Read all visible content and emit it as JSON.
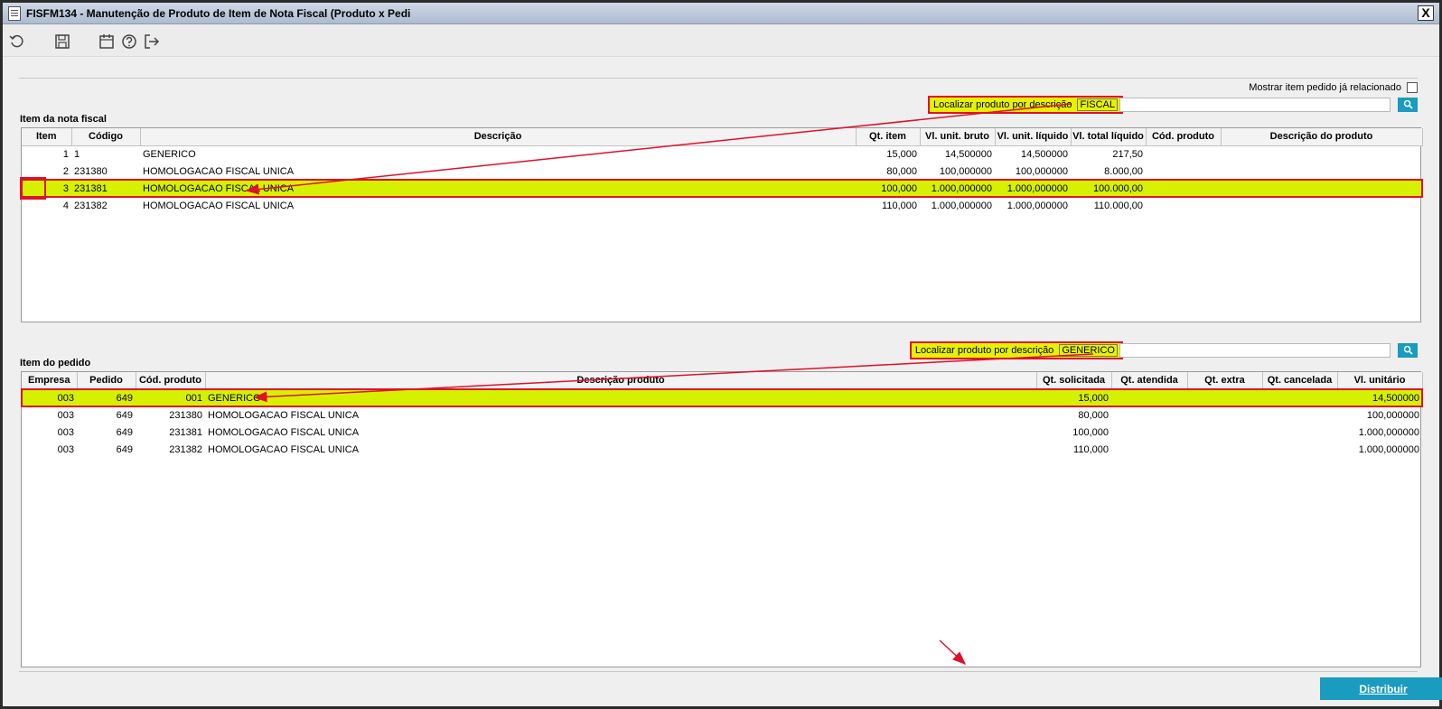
{
  "window": {
    "title": "FISFM134 - Manutenção de Produto de Item de Nota Fiscal (Produto x Pedi",
    "close_label": "X"
  },
  "toolbar": {
    "buttons": [
      {
        "name": "refresh-icon"
      },
      {
        "name": "save-icon"
      },
      {
        "name": "calendar-icon"
      },
      {
        "name": "help-icon"
      },
      {
        "name": "exit-icon"
      }
    ]
  },
  "options": {
    "show_related_label": "Mostrar item pedido já relacionado"
  },
  "nota_fiscal": {
    "section_title": "Item da nota fiscal",
    "search_label": "Localizar produto por descrição",
    "search_value": "FISCAL",
    "columns": [
      "Item",
      "Código",
      "Descrição",
      "Qt. item",
      "Vl. unit. bruto",
      "Vl. unit. líquido",
      "Vl. total líquido",
      "Cód. produto",
      "Descrição do produto"
    ],
    "rows": [
      {
        "item": "1",
        "codigo": "1",
        "descricao": "GENERICO",
        "qt_item": "15,000",
        "vl_unit_bruto": "14,500000",
        "vl_unit_liquido": "14,500000",
        "vl_total_liquido": "217,50",
        "cod_produto": "",
        "desc_produto": ""
      },
      {
        "item": "2",
        "codigo": "231380",
        "descricao": "HOMOLOGACAO FISCAL UNICA",
        "qt_item": "80,000",
        "vl_unit_bruto": "100,000000",
        "vl_unit_liquido": "100,000000",
        "vl_total_liquido": "8.000,00",
        "cod_produto": "",
        "desc_produto": ""
      },
      {
        "item": "3",
        "codigo": "231381",
        "descricao": "HOMOLOGACAO FISCAL UNICA",
        "qt_item": "100,000",
        "vl_unit_bruto": "1.000,000000",
        "vl_unit_liquido": "1.000,000000",
        "vl_total_liquido": "100.000,00",
        "cod_produto": "",
        "desc_produto": ""
      },
      {
        "item": "4",
        "codigo": "231382",
        "descricao": "HOMOLOGACAO FISCAL UNICA",
        "qt_item": "110,000",
        "vl_unit_bruto": "1.000,000000",
        "vl_unit_liquido": "1.000,000000",
        "vl_total_liquido": "110.000,00",
        "cod_produto": "",
        "desc_produto": ""
      }
    ]
  },
  "pedido": {
    "section_title": "Item do pedido",
    "search_label": "Localizar produto por descrição",
    "search_value": "GENERICO",
    "columns": [
      "Empresa",
      "Pedido",
      "Cód. produto",
      "Descrição produto",
      "Qt. solicitada",
      "Qt. atendida",
      "Qt. extra",
      "Qt. cancelada",
      "Vl. unitário"
    ],
    "rows": [
      {
        "empresa": "003",
        "pedido": "649",
        "cod_produto": "001",
        "descricao": "GENERICO",
        "qt_solicitada": "15,000",
        "qt_atendida": "",
        "qt_extra": "",
        "qt_cancelada": "",
        "vl_unitario": "14,500000"
      },
      {
        "empresa": "003",
        "pedido": "649",
        "cod_produto": "231380",
        "descricao": "HOMOLOGACAO FISCAL UNICA",
        "qt_solicitada": "80,000",
        "qt_atendida": "",
        "qt_extra": "",
        "qt_cancelada": "",
        "vl_unitario": "100,000000"
      },
      {
        "empresa": "003",
        "pedido": "649",
        "cod_produto": "231381",
        "descricao": "HOMOLOGACAO FISCAL UNICA",
        "qt_solicitada": "100,000",
        "qt_atendida": "",
        "qt_extra": "",
        "qt_cancelada": "",
        "vl_unitario": "1.000,000000"
      },
      {
        "empresa": "003",
        "pedido": "649",
        "cod_produto": "231382",
        "descricao": "HOMOLOGACAO FISCAL UNICA",
        "qt_solicitada": "110,000",
        "qt_atendida": "",
        "qt_extra": "",
        "qt_cancelada": "",
        "vl_unitario": "1.000,000000"
      }
    ]
  },
  "actions": {
    "distribuir_label": "Distribuir"
  },
  "colors": {
    "accent": "#1a9bc0",
    "highlight": "#d6f100",
    "annotation": "#e0102a"
  }
}
